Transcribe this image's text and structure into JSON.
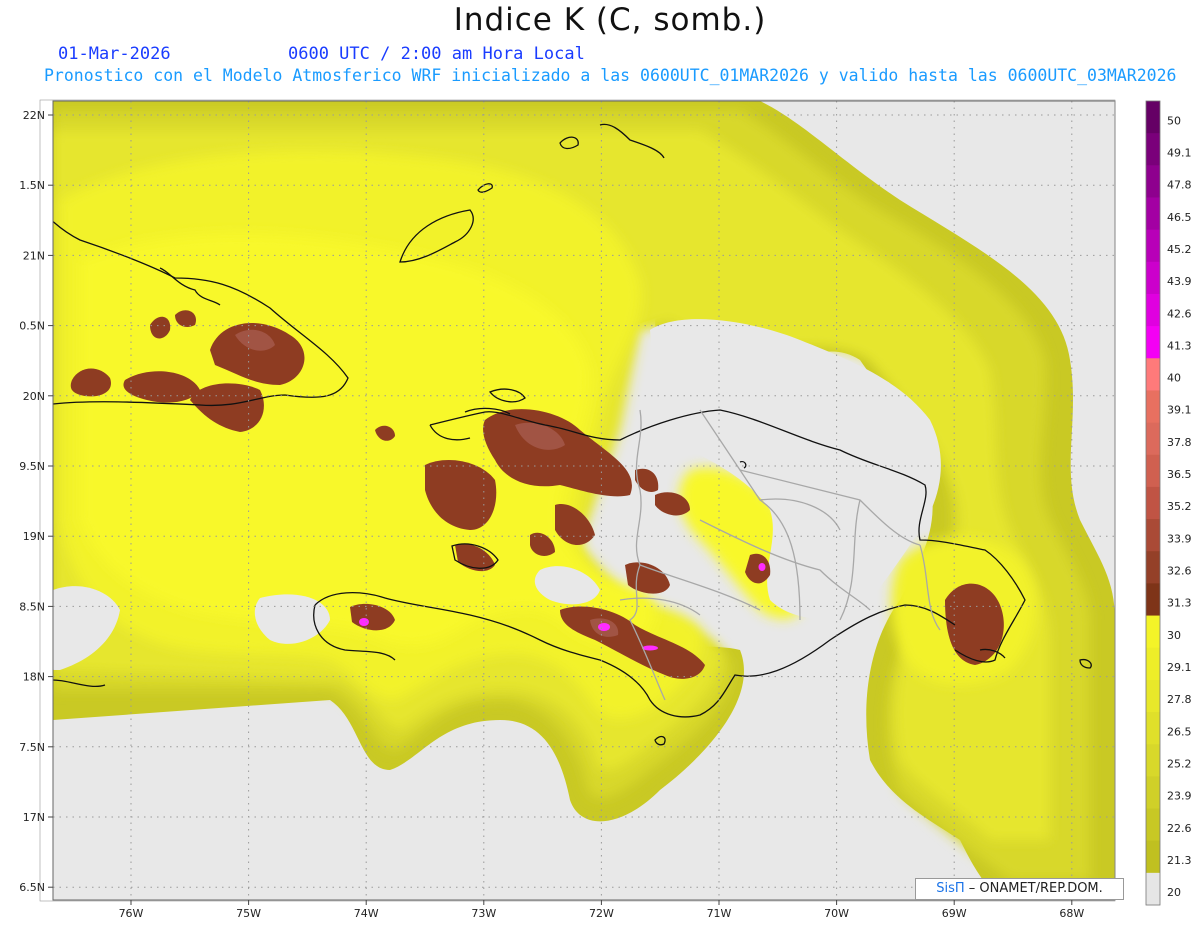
{
  "title": "Indice K (C, somb.)",
  "date": "01-Mar-2026",
  "utc_time": "0600 UTC / 2:00 am Hora Local",
  "subtitle": "Pronostico con el Modelo Atmosferico WRF inicializado a las 0600UTC_01MAR2026 y valido hasta las  0600UTC_03MAR2026",
  "credit": {
    "brand": "SisΠ",
    "text": "– ONAMET/REP.DOM."
  },
  "map": {
    "lon_labels": [
      "76W",
      "75W",
      "74W",
      "73W",
      "72W",
      "71W",
      "70W",
      "69W",
      "68W"
    ],
    "lat_labels": [
      "22N",
      "1.5N",
      "21N",
      "0.5N",
      "20N",
      "9.5N",
      "19N",
      "8.5N",
      "18N",
      "7.5N",
      "17N",
      "6.5N"
    ]
  },
  "colors": {
    "ocean": "#e8e8e8",
    "k20": "#c8c820",
    "k22": "#d4d42a",
    "k24": "#e2e22e",
    "k26": "#eeee30",
    "k28": "#f8f828",
    "k30": "#8b3a1c",
    "k33": "#a65a48",
    "k36": "#c8786a",
    "k40": "#ff2cff",
    "k50": "#6a006a"
  },
  "colorbar": {
    "labels": [
      "50",
      "49.1",
      "47.8",
      "46.5",
      "45.2",
      "43.9",
      "42.6",
      "41.3",
      "40",
      "39.1",
      "37.8",
      "36.5",
      "35.2",
      "33.9",
      "32.6",
      "31.3",
      "30",
      "29.1",
      "27.8",
      "26.5",
      "25.2",
      "23.9",
      "22.6",
      "21.3",
      "20"
    ],
    "swatches": [
      "#650065",
      "#7a007a",
      "#8e008e",
      "#a300a3",
      "#b800b8",
      "#cc00cc",
      "#e000e0",
      "#f400f4",
      "#ff7a7a",
      "#e87060",
      "#dc6a5c",
      "#d06050",
      "#c05444",
      "#aa4a36",
      "#944028",
      "#7e3418",
      "#f4f428",
      "#eeee28",
      "#e8e82a",
      "#e0e02a",
      "#d8d82a",
      "#d0d028",
      "#c8c824",
      "#c0c020",
      "#e6e6e6"
    ]
  }
}
